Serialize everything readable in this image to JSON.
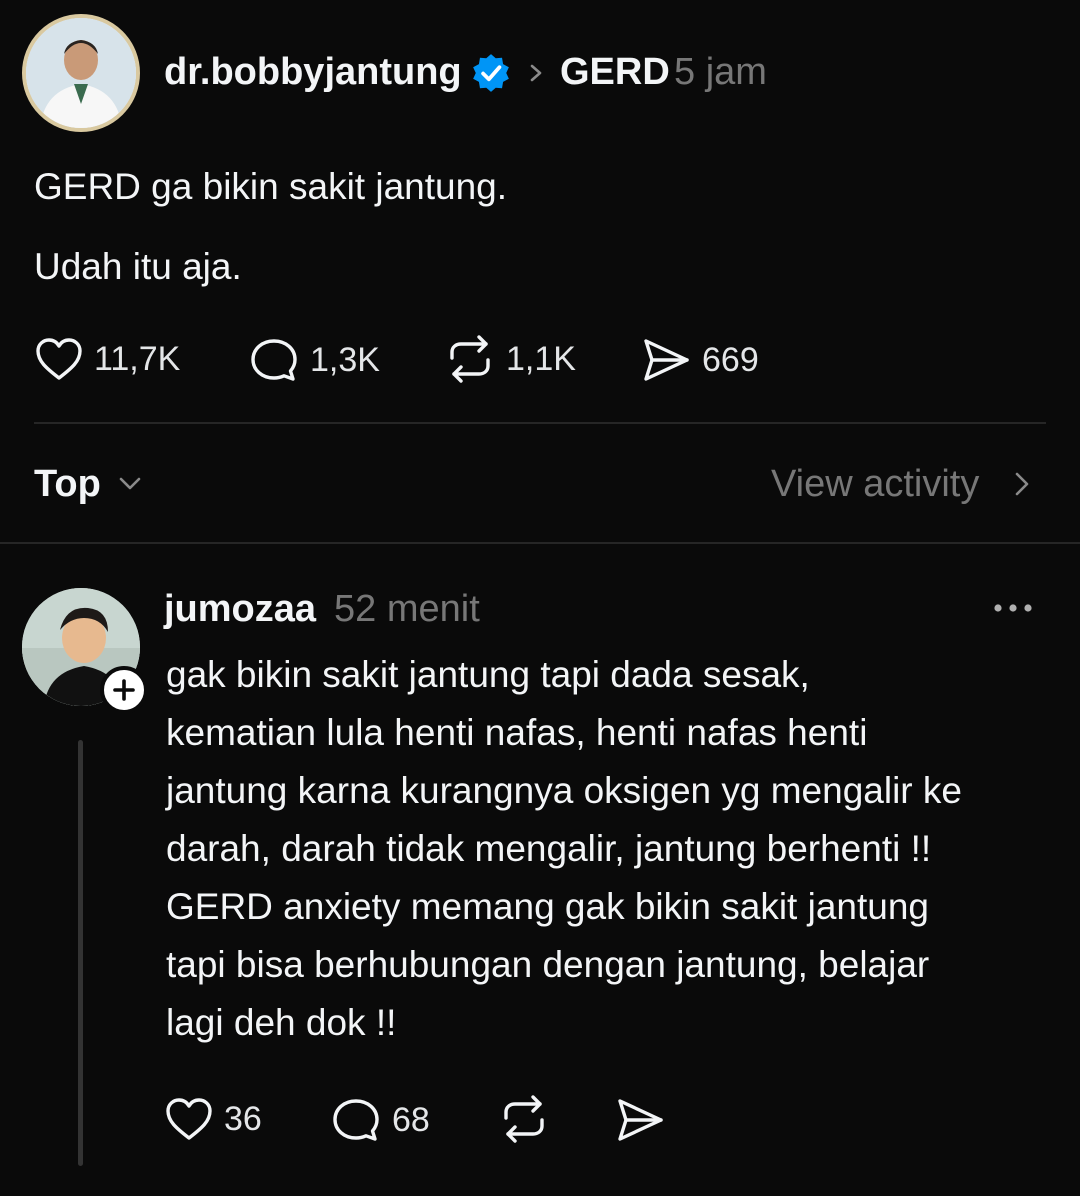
{
  "post": {
    "author": "dr.bobbyjantung",
    "topic": "GERD",
    "time": "5 jam",
    "lines": [
      "GERD ga bikin sakit jantung.",
      "Udah itu aja."
    ],
    "stats": {
      "likes": "11,7K",
      "replies": "1,3K",
      "reposts": "1,1K",
      "shares": "669"
    }
  },
  "sort": {
    "label": "Top",
    "view_activity": "View activity"
  },
  "reply": {
    "author": "jumozaa",
    "time": "52 menit",
    "lines": [
      "gak bikin sakit jantung tapi dada sesak,",
      "kematian lula henti nafas, henti nafas henti",
      "jantung karna kurangnya oksigen yg mengalir ke",
      "darah, darah tidak mengalir, jantung berhenti !!",
      "GERD anxiety memang gak bikin sakit jantung",
      "tapi bisa berhubungan dengan jantung, belajar",
      "lagi deh dok !!"
    ],
    "stats": {
      "likes": "36",
      "replies": "68"
    }
  },
  "icons": {
    "verified": "verified-badge-icon",
    "like": "heart-icon",
    "reply": "comment-icon",
    "repost": "repost-icon",
    "share": "send-icon",
    "more": "more-icon",
    "follow": "plus-icon"
  },
  "colors": {
    "background": "#0a0a0a",
    "verified": "#0095f6",
    "muted": "#777777"
  }
}
